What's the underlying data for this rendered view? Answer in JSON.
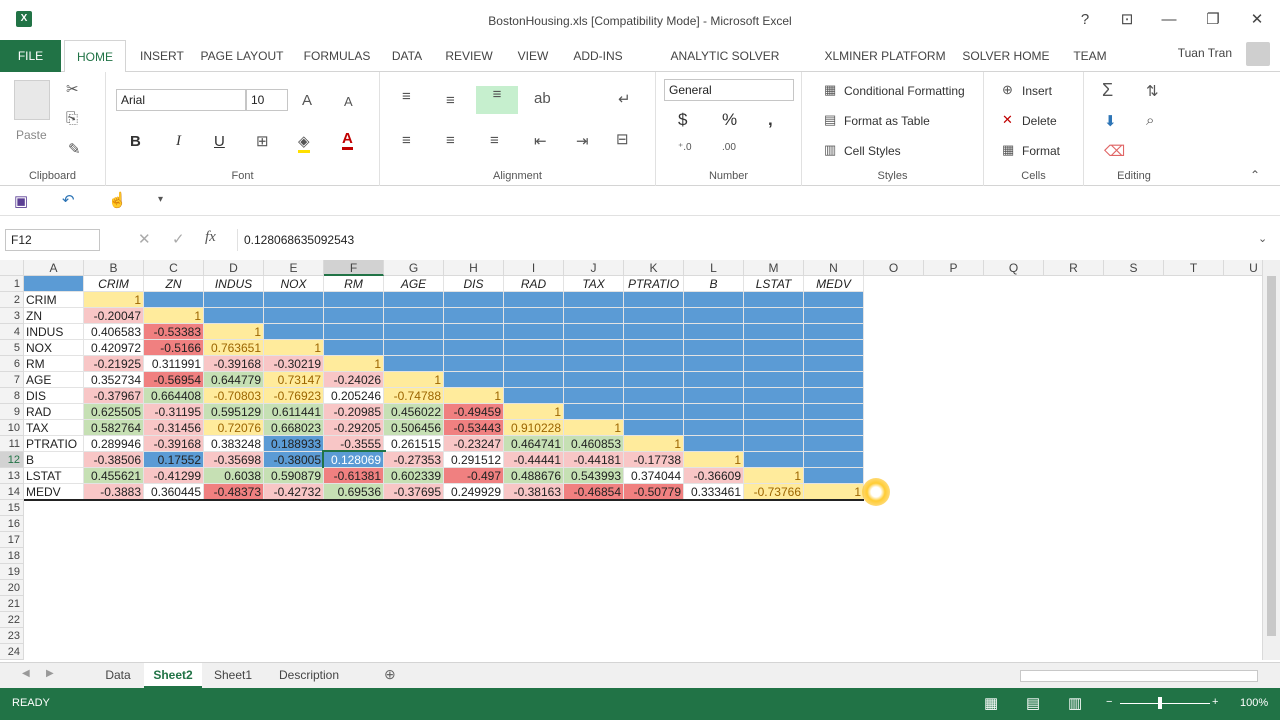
{
  "window": {
    "title": "BostonHousing.xls  [Compatibility Mode] - Microsoft Excel",
    "app_icon": "X"
  },
  "tabs": [
    "HOME",
    "INSERT",
    "PAGE LAYOUT",
    "FORMULAS",
    "DATA",
    "REVIEW",
    "VIEW",
    "ADD-INS",
    "ANALYTIC SOLVER PLATFORM",
    "XLMINER PLATFORM",
    "SOLVER HOME",
    "TEAM"
  ],
  "file_tab": "FILE",
  "user": "Tuan Tran",
  "ribbon": {
    "clipboard": {
      "label": "Clipboard",
      "paste": "Paste"
    },
    "font": {
      "label": "Font",
      "name": "Arial",
      "size": "10",
      "bold": "B",
      "italic": "I",
      "underline": "U"
    },
    "alignment": {
      "label": "Alignment"
    },
    "number": {
      "label": "Number",
      "format": "General",
      "currency": "$",
      "percent": "%",
      "comma": ","
    },
    "styles": {
      "label": "Styles",
      "cond": "Conditional Formatting",
      "table": "Format as Table",
      "cellstyles": "Cell Styles"
    },
    "cells": {
      "label": "Cells",
      "insert": "Insert",
      "delete": "Delete",
      "format": "Format"
    },
    "editing": {
      "label": "Editing"
    }
  },
  "formula_bar": {
    "name_box": "F12",
    "value": "0.128068635092543"
  },
  "columns": [
    "A",
    "B",
    "C",
    "D",
    "E",
    "F",
    "G",
    "H",
    "I",
    "J",
    "K",
    "L",
    "M",
    "N",
    "O",
    "P",
    "Q",
    "R",
    "S",
    "T",
    "U"
  ],
  "rows": [
    "1",
    "2",
    "3",
    "4",
    "5",
    "6",
    "7",
    "8",
    "9",
    "10",
    "11",
    "12",
    "13",
    "14",
    "15",
    "16",
    "17",
    "18",
    "19",
    "20",
    "21",
    "22",
    "23",
    "24"
  ],
  "header_row": [
    "",
    "CRIM",
    "ZN",
    "INDUS",
    "NOX",
    "RM",
    "AGE",
    "DIS",
    "RAD",
    "TAX",
    "PTRATIO",
    "B",
    "LSTAT",
    "MEDV"
  ],
  "row_labels": [
    "CRIM",
    "ZN",
    "INDUS",
    "NOX",
    "RM",
    "AGE",
    "DIS",
    "RAD",
    "TAX",
    "PTRATIO",
    "B",
    "LSTAT",
    "MEDV"
  ],
  "matrix": [
    [
      "1"
    ],
    [
      "-0.20047",
      "1"
    ],
    [
      "0.406583",
      "-0.53383",
      "1"
    ],
    [
      "0.420972",
      "-0.5166",
      "0.763651",
      "1"
    ],
    [
      "-0.21925",
      "0.311991",
      "-0.39168",
      "-0.30219",
      "1"
    ],
    [
      "0.352734",
      "-0.56954",
      "0.644779",
      "0.73147",
      "-0.24026",
      "1"
    ],
    [
      "-0.37967",
      "0.664408",
      "-0.70803",
      "-0.76923",
      "0.205246",
      "-0.74788",
      "1"
    ],
    [
      "0.625505",
      "-0.31195",
      "0.595129",
      "0.611441",
      "-0.20985",
      "0.456022",
      "-0.49459",
      "1"
    ],
    [
      "0.582764",
      "-0.31456",
      "0.72076",
      "0.668023",
      "-0.29205",
      "0.506456",
      "-0.53443",
      "0.910228",
      "1"
    ],
    [
      "0.289946",
      "-0.39168",
      "0.383248",
      "0.188933",
      "-0.3555",
      "0.261515",
      "-0.23247",
      "0.464741",
      "0.460853",
      "1"
    ],
    [
      "-0.38506",
      "0.17552",
      "-0.35698",
      "-0.38005",
      "0.128069",
      "-0.27353",
      "0.291512",
      "-0.44441",
      "-0.44181",
      "-0.17738",
      "1"
    ],
    [
      "0.455621",
      "-0.41299",
      "0.6038",
      "0.590879",
      "-0.61381",
      "0.602339",
      "-0.497",
      "0.488676",
      "0.543993",
      "0.374044",
      "-0.36609",
      "1"
    ],
    [
      "-0.3883",
      "0.360445",
      "-0.48373",
      "-0.42732",
      "0.69536",
      "-0.37695",
      "0.249929",
      "-0.38163",
      "-0.46854",
      "-0.50779",
      "0.333461",
      "-0.73766",
      "1"
    ]
  ],
  "sheets": [
    "Data",
    "Sheet2",
    "Sheet1",
    "Description"
  ],
  "active_sheet": "Sheet2",
  "status": {
    "mode": "READY",
    "zoom": "100%"
  },
  "colors": {
    "accent": "#217346",
    "blue": "#5b9bd5",
    "yellow": "#ffeb9c",
    "red": "#f4a6a6",
    "green": "#c6e0b4"
  }
}
